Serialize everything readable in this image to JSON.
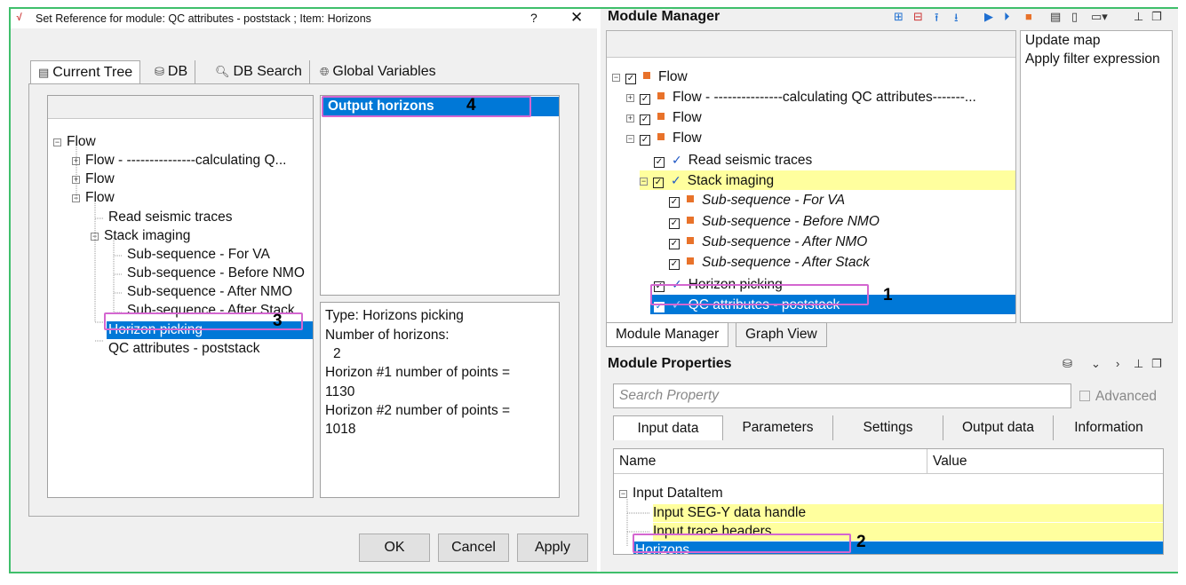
{
  "dialog": {
    "title": "Set Reference for module: QC attributes - poststack ; Item: Horizons",
    "help": "?",
    "close": "✕",
    "tabs": [
      "Current Tree",
      "DB",
      "DB Search",
      "Global Variables"
    ],
    "tree": [
      {
        "label": "Flow",
        "expander": "⊟"
      },
      {
        "label": "Flow - ---------------calculating Q...",
        "expander": "⊞"
      },
      {
        "label": "Flow",
        "expander": "⊞"
      },
      {
        "label": "Flow",
        "expander": "⊟"
      },
      {
        "label": "Read seismic traces"
      },
      {
        "label": "Stack imaging",
        "expander": "⊟"
      },
      {
        "label": "Sub-sequence - For VA"
      },
      {
        "label": "Sub-sequence - Before NMO"
      },
      {
        "label": "Sub-sequence - After NMO"
      },
      {
        "label": "Sub-sequence - After Stack"
      },
      {
        "label": "Horizon picking"
      },
      {
        "label": "QC attributes - poststack"
      }
    ],
    "output_item": "Output horizons",
    "info": [
      "Type: Horizons picking",
      "Number of horizons:",
      "2",
      "Horizon #1 number of points  =",
      "1130",
      "Horizon #2 number of points  =",
      "1018"
    ],
    "buttons": {
      "ok": "OK",
      "cancel": "Cancel",
      "apply": "Apply"
    }
  },
  "module_manager": {
    "title": "Module Manager",
    "tree": [
      {
        "label": "Flow",
        "mark": "square"
      },
      {
        "label": "Flow - ---------------calculating QC attributes-------...",
        "mark": "square"
      },
      {
        "label": "Flow",
        "mark": "square"
      },
      {
        "label": "Flow",
        "mark": "square"
      },
      {
        "label": "Read seismic traces",
        "mark": "check"
      },
      {
        "label": "Stack imaging",
        "mark": "check"
      },
      {
        "label": "Sub-sequence - For VA",
        "mark": "square"
      },
      {
        "label": "Sub-sequence - Before NMO",
        "mark": "square"
      },
      {
        "label": "Sub-sequence - After NMO",
        "mark": "square"
      },
      {
        "label": "Sub-sequence - After Stack",
        "mark": "square"
      },
      {
        "label": "Horizon picking",
        "mark": "check"
      },
      {
        "label": "QC attributes - poststack",
        "mark": "check"
      }
    ],
    "side_items": [
      "Update map",
      "Apply filter expression"
    ],
    "bottom_tabs": [
      "Module Manager",
      "Graph View"
    ]
  },
  "module_properties": {
    "title": "Module Properties",
    "search_placeholder": "Search Property",
    "advanced_label": "Advanced",
    "tabs": [
      "Input data",
      "Parameters",
      "Settings",
      "Output data",
      "Information"
    ],
    "columns": [
      "Name",
      "Value"
    ],
    "rows": [
      "Input DataItem",
      "Input SEG-Y data handle",
      "Input trace headers",
      "Horizons"
    ]
  },
  "callouts": [
    "1",
    "2",
    "3",
    "4"
  ],
  "colors": {
    "selection": "#0078d7",
    "highlight": "#ffff9e",
    "callout": "#d466d0",
    "frame": "#3fbf6b",
    "flow_marker": "#e8722a"
  }
}
